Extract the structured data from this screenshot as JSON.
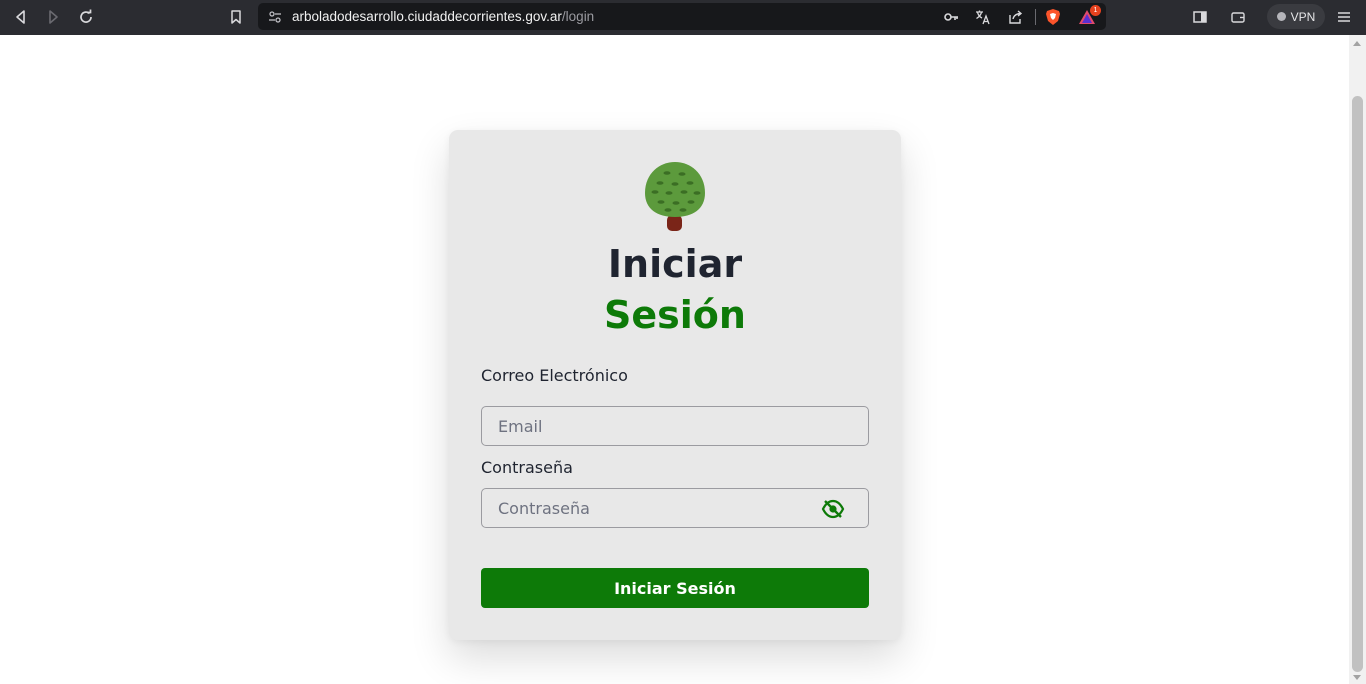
{
  "browser": {
    "url_domain": "arboladodesarrollo.ciudaddecorrientes.gov.ar",
    "url_path": "/login",
    "notification_count": "1",
    "vpn_label": "VPN",
    "icons": [
      "back-icon",
      "forward-icon",
      "reload-icon",
      "bookmark-icon",
      "site-info-icon",
      "key-icon",
      "translate-icon",
      "share-icon",
      "brave-shield-icon",
      "brave-rewards-icon",
      "sidebar-icon",
      "wallet-icon",
      "menu-icon"
    ]
  },
  "login": {
    "logo_icon": "tree-icon",
    "title_line1": "Iniciar",
    "title_line2": "Sesión",
    "email_label": "Correo Electrónico",
    "email_placeholder": "Email",
    "email_value": "",
    "password_label": "Contraseña",
    "password_placeholder": "Contraseña",
    "password_value": "",
    "password_toggle_icon": "eye-off-icon",
    "submit_label": "Iniciar Sesión"
  },
  "colors": {
    "accent_green": "#0d7a08",
    "title_dark": "#1f2430",
    "card_bg": "#e8e8e8",
    "chrome_bg": "#2b2c31"
  }
}
